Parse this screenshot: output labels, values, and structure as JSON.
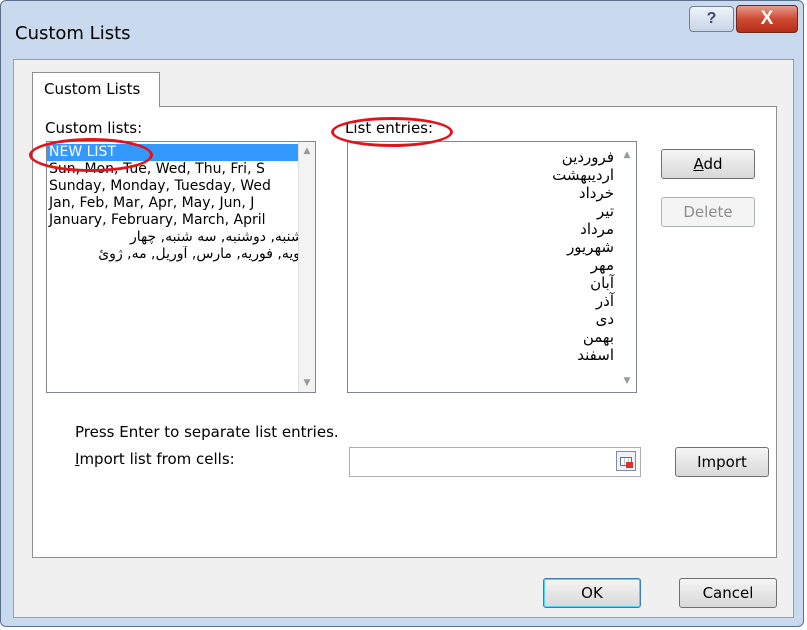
{
  "window": {
    "title": "Custom Lists",
    "help_label": "?",
    "close_label": "X"
  },
  "tab": {
    "label": "Custom Lists"
  },
  "custom_lists": {
    "label": "Custom lists:",
    "items": [
      "NEW LIST",
      "Sun, Mon, Tue, Wed, Thu, Fri, S",
      "Sunday, Monday, Tuesday, Wed",
      "Jan, Feb, Mar, Apr, May, Jun, J",
      "January, February, March, April",
      "یکشنبه, دوشنبه, سه شنبه, چهار",
      "ژانویه, فوریه, مارس, آوریل, مه, ژوئ"
    ],
    "selected_index": 0
  },
  "list_entries": {
    "label": "List entries:",
    "entries": [
      "فروردین",
      "اردیبهشت",
      "خرداد",
      "تیر",
      "مرداد",
      "شهریور",
      "مهر",
      "آبان",
      "آذر",
      "دی",
      "بهمن",
      "اسفند"
    ]
  },
  "buttons": {
    "add": "Add",
    "delete": "Delete",
    "import": "Import",
    "ok": "OK",
    "cancel": "Cancel"
  },
  "hint": "Press Enter to separate list entries.",
  "import": {
    "label": "Import list from cells:",
    "value": ""
  },
  "scroll_arrows": {
    "up": "▲",
    "down": "▼"
  },
  "colors": {
    "selection": "#3399ff",
    "annotation": "#e0141a",
    "title_bar": "#c9d9ee",
    "close_button": "#c8452f"
  },
  "icons": {
    "help": "question-mark-icon",
    "close": "close-icon",
    "range_select": "range-select-icon"
  }
}
